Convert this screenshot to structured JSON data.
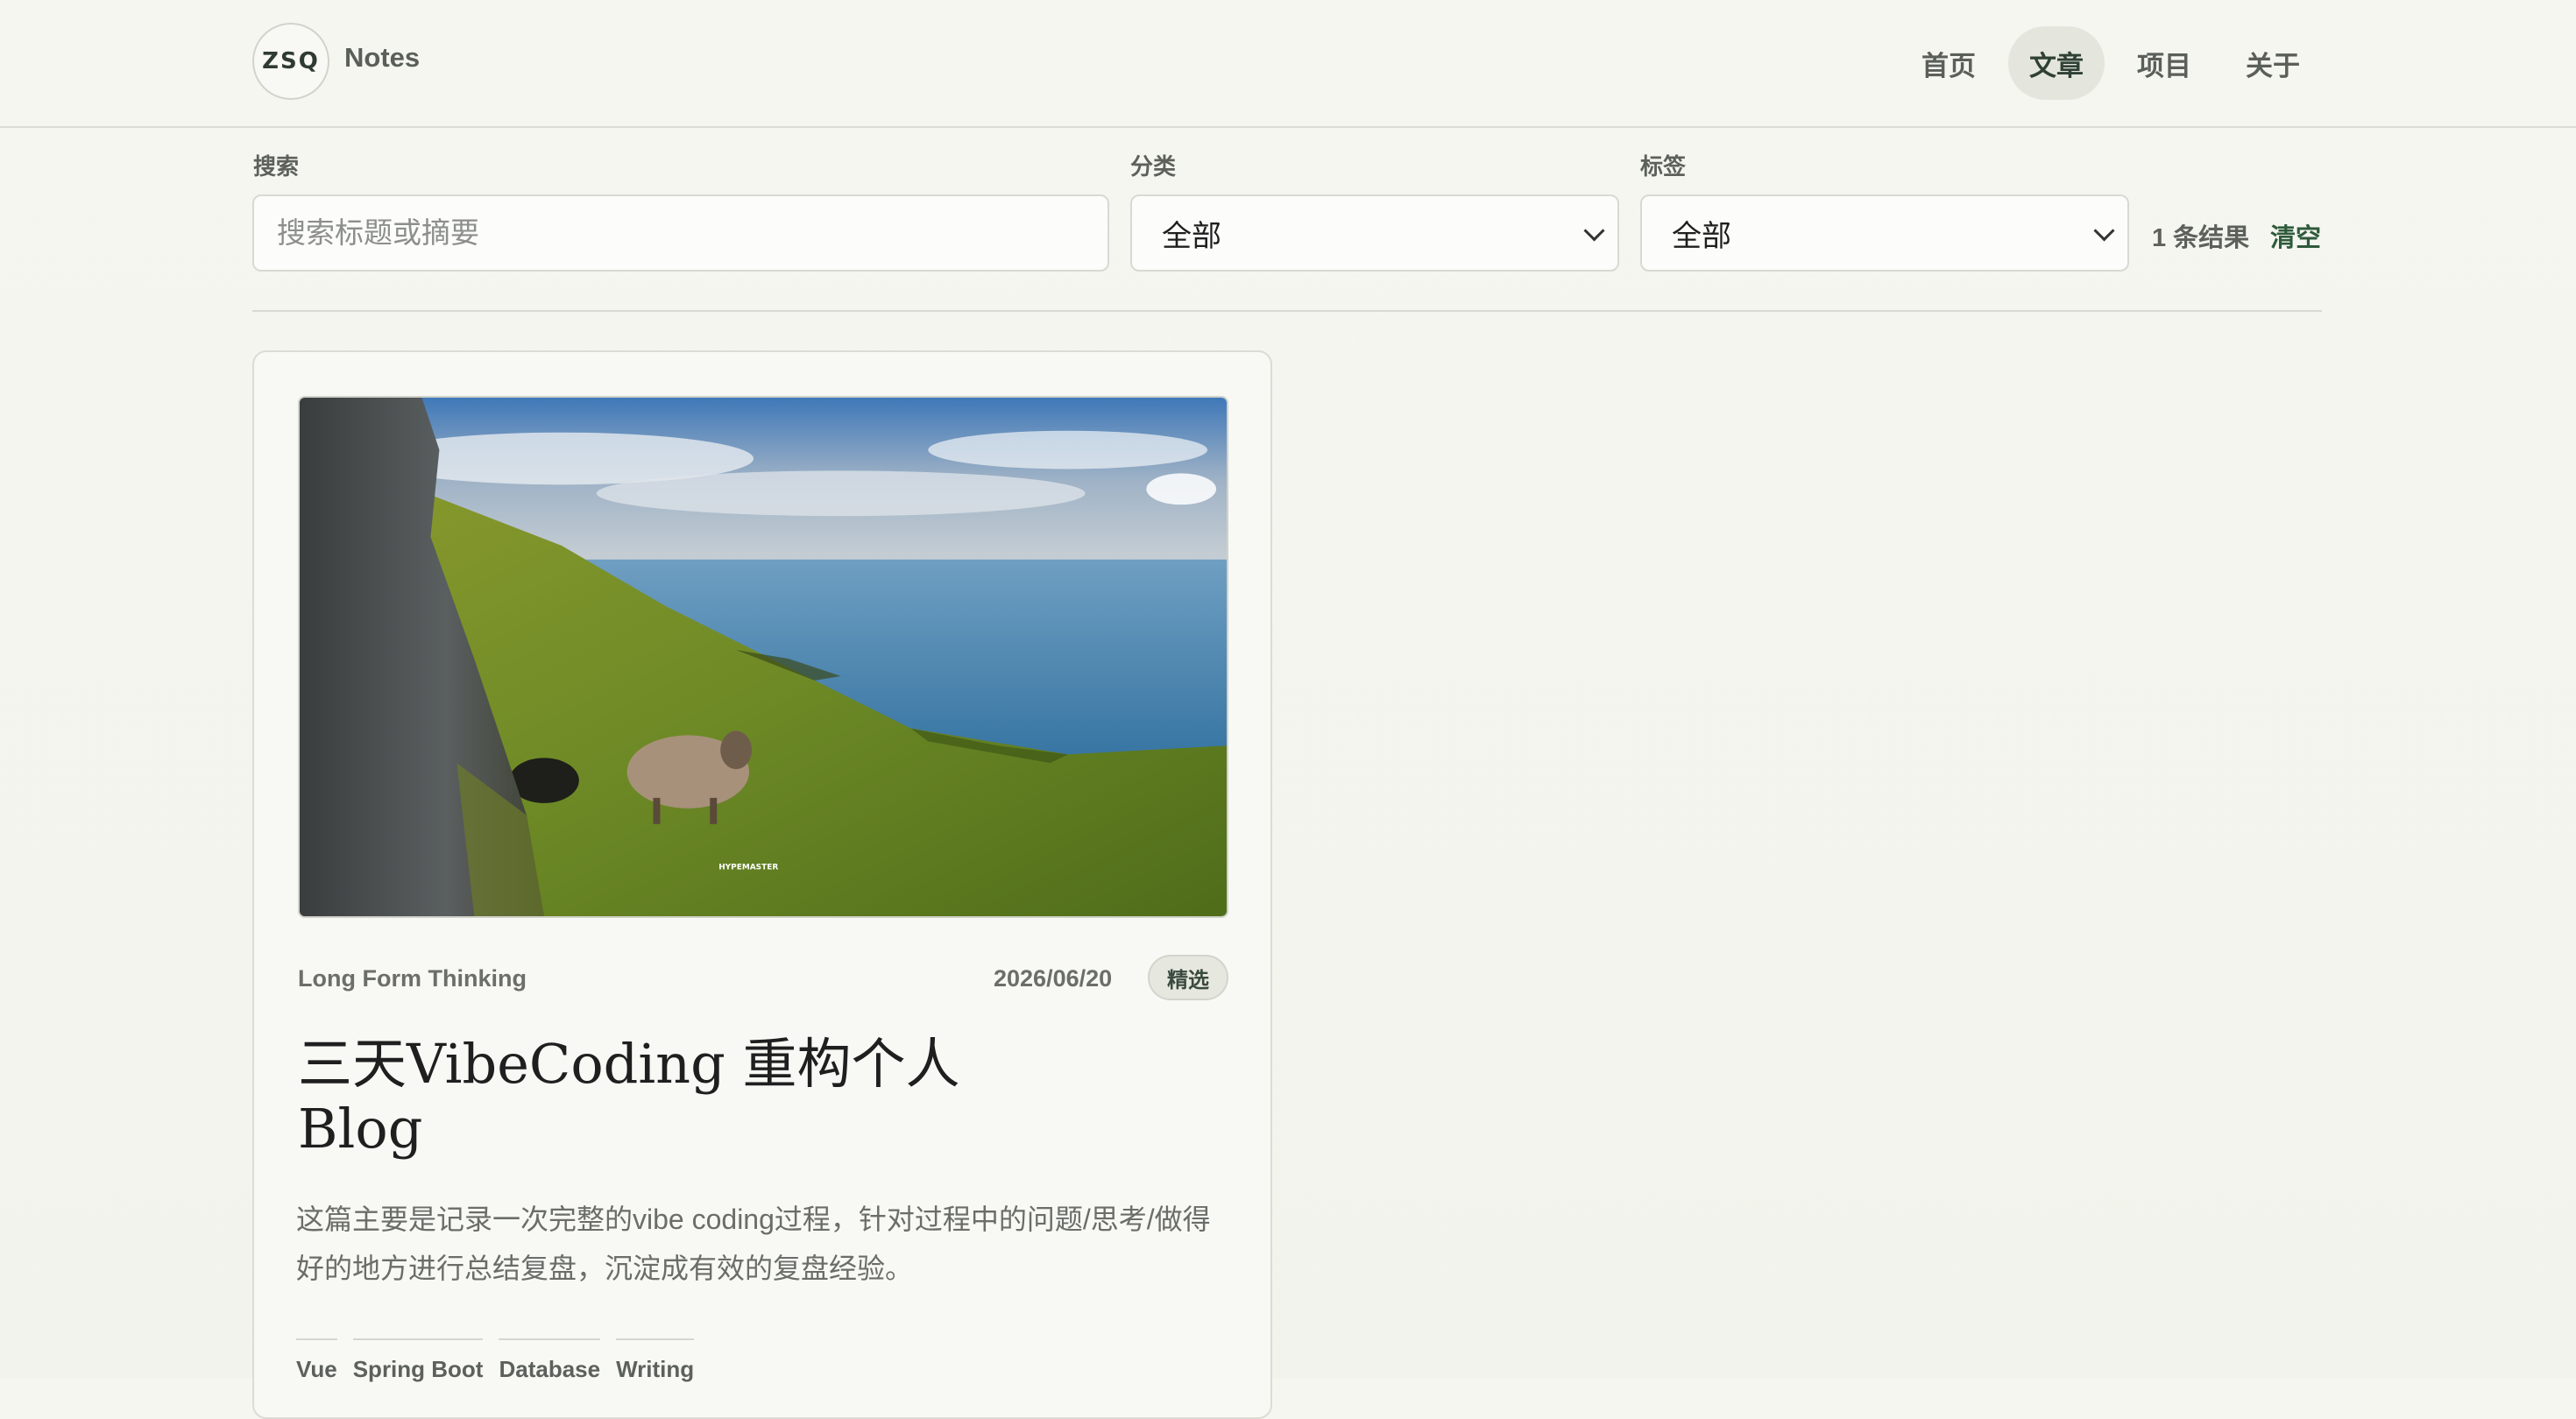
{
  "brand": {
    "logo_text": "ZSQ",
    "name": "Notes"
  },
  "nav": {
    "items": [
      {
        "label": "首页",
        "active": false
      },
      {
        "label": "文章",
        "active": true
      },
      {
        "label": "项目",
        "active": false
      },
      {
        "label": "关于",
        "active": false
      }
    ]
  },
  "filters": {
    "search": {
      "label": "搜索",
      "value": "",
      "placeholder": "搜索标题或摘要"
    },
    "category": {
      "label": "分类",
      "selected": "全部"
    },
    "tag": {
      "label": "标签",
      "selected": "全部"
    },
    "result_count": "1 条结果",
    "clear_label": "清空"
  },
  "posts": [
    {
      "category": "Long Form Thinking",
      "date": "2026/06/20",
      "badge": "精选",
      "title": "三天VibeCoding 重构个人Blog",
      "summary": "这篇主要是记录一次完整的vibe coding过程，针对过程中的问题/思考/做得好的地方进行总结复盘，沉淀成有效的复盘经验。",
      "tags": [
        "Vue",
        "Spring Boot",
        "Database",
        "Writing"
      ],
      "cover_watermark": "HYPEMASTER"
    }
  ],
  "colors": {
    "background": "#f6f6f1",
    "accent": "#2f5a3c",
    "active_nav_bg": "#e4e6de"
  }
}
